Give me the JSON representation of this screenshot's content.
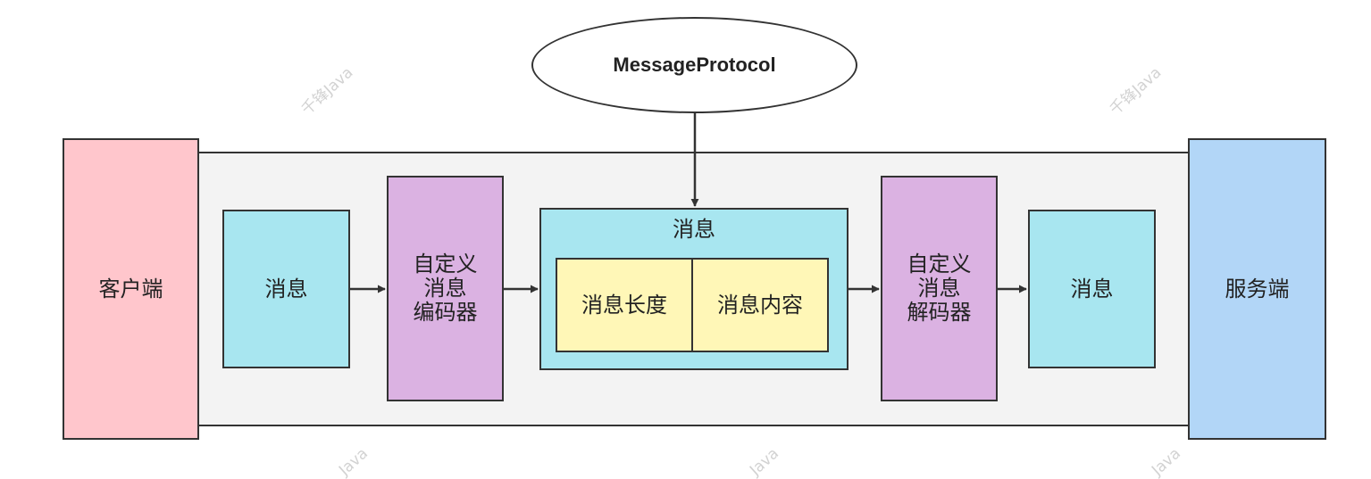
{
  "colors": {
    "client": "#ffc6cc",
    "server": "#b2d6f7",
    "channel": "#f3f3f3",
    "message": "#a8e6f0",
    "codec": "#dbb2e2",
    "field": "#fff7b7",
    "stroke": "#333333"
  },
  "nodes": {
    "protocol": "MessageProtocol",
    "client": "客户端",
    "server": "服务端",
    "msg_left": "消息",
    "encoder": "自定义\n消息\n编码器",
    "msg_center_title": "消息",
    "msg_length": "消息长度",
    "msg_content": "消息内容",
    "decoder": "自定义\n消息\n解码器",
    "msg_right": "消息"
  },
  "watermarks": {
    "text": "千锋Java",
    "fragment": "Java"
  }
}
